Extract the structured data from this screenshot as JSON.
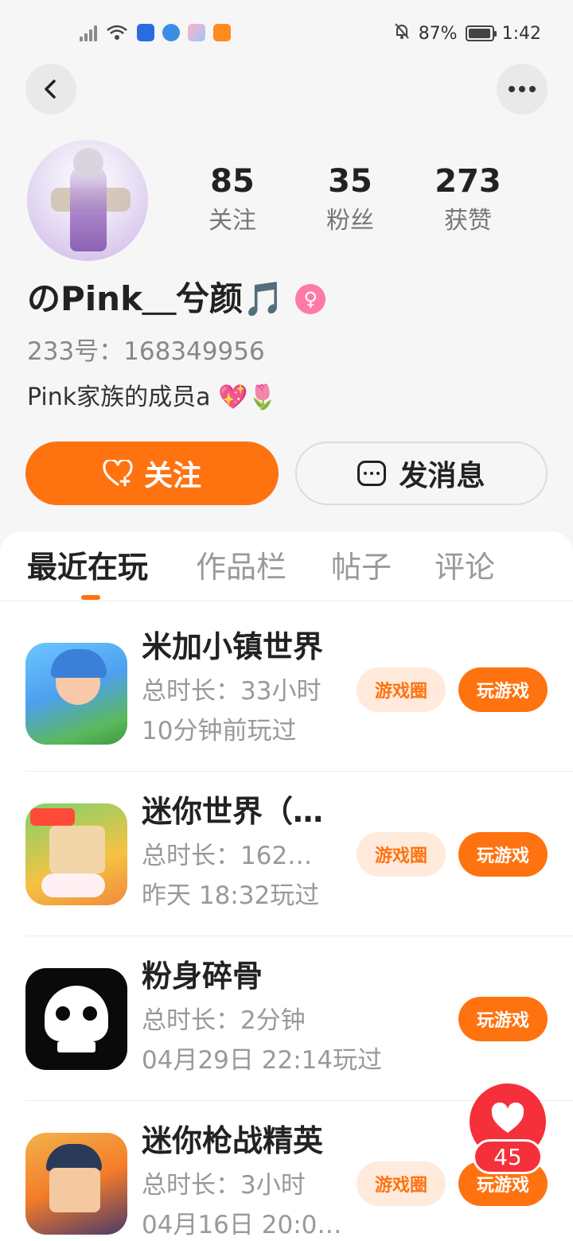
{
  "status_bar": {
    "battery": "87%",
    "time": "1:42"
  },
  "profile": {
    "stats": [
      {
        "value": "85",
        "label": "关注"
      },
      {
        "value": "35",
        "label": "粉丝"
      },
      {
        "value": "273",
        "label": "获赞"
      }
    ],
    "username": "のPink＿兮颜🎵",
    "user_id": "233号：168349956",
    "bio": "Pink家族的成员a 💖🌷",
    "follow_label": "关注",
    "message_label": "发消息"
  },
  "tabs": [
    "最近在玩",
    "作品栏",
    "帖子",
    "评论"
  ],
  "games": [
    {
      "title": "米加小镇世界",
      "duration": "总时长：33小时",
      "last_played": "10分钟前玩过",
      "circle_label": "游戏圈",
      "play_label": "玩游戏"
    },
    {
      "title": "迷你世界（…",
      "duration": "总时长：162…",
      "last_played": "昨天 18:32玩过",
      "circle_label": "游戏圈",
      "play_label": "玩游戏"
    },
    {
      "title": "粉身碎骨",
      "duration": "总时长：2分钟",
      "last_played": "04月29日 22:14玩过",
      "circle_label": "",
      "play_label": "玩游戏"
    },
    {
      "title": "迷你枪战精英",
      "duration": "总时长：3小时",
      "last_played": "04月16日 20:0…",
      "circle_label": "游戏圈",
      "play_label": "玩游戏"
    }
  ],
  "like_fab": {
    "count": "45"
  },
  "colors": {
    "accent": "#ff7210",
    "like": "#f5303a"
  }
}
